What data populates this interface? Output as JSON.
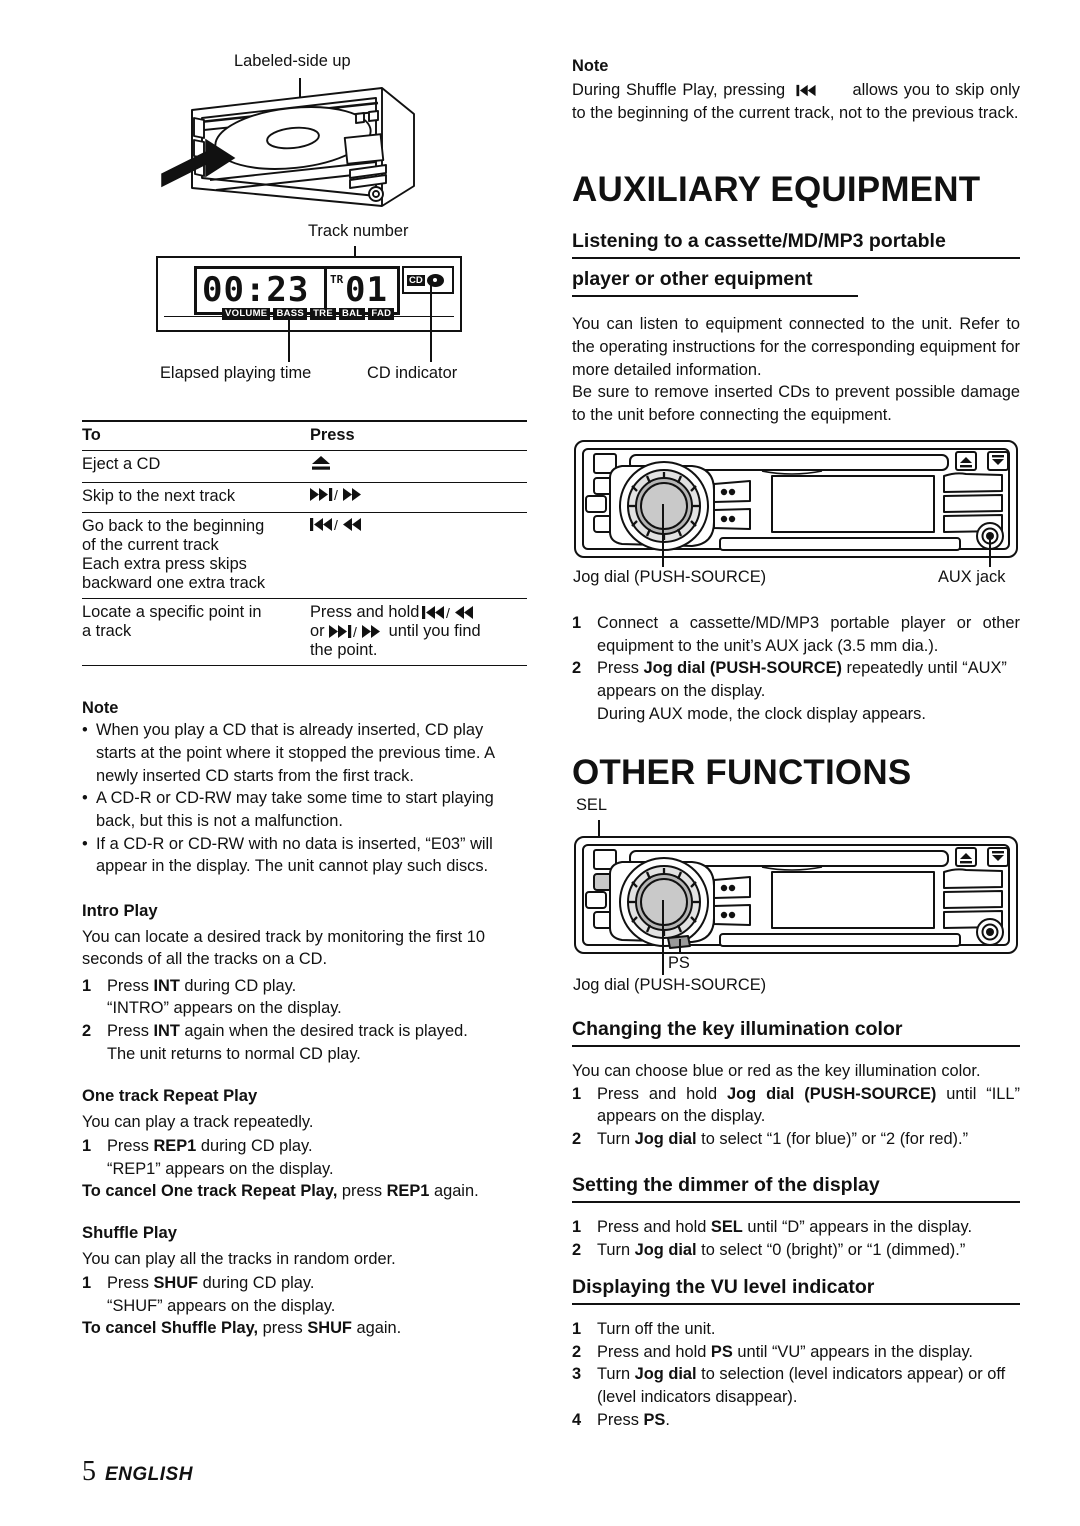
{
  "document": {
    "footer": {
      "page_number": "5",
      "language": "ENGLISH"
    }
  },
  "left_column": {
    "figure_cd_insert": {
      "label_top": "Labeled-side up"
    },
    "figure_display": {
      "label_track_number": "Track number",
      "label_elapsed": "Elapsed playing time",
      "label_cd_indicator": "CD indicator",
      "lcd": {
        "elapsed_time": "00:23",
        "track_prefix": "TR",
        "track_number": "01",
        "cd_tag": "CD",
        "indicators": [
          "VOLUME",
          "BASS",
          "TRE",
          "BAL",
          "FAD"
        ]
      }
    },
    "key_table": {
      "headers": {
        "to": "To",
        "press": "Press"
      },
      "rows": [
        {
          "to": "Eject a CD",
          "press": "⏏",
          "press_is_glyph": true
        },
        {
          "to": "Skip to the next track",
          "press": "▶▶⏸/▶▶"
        },
        {
          "to": "Go back to the beginning of the current track\nEach extra press skips backward one extra track",
          "press": "⏮◀◀/◀◀"
        },
        {
          "to": "Locate a specific point in a track",
          "press": "Press and hold ⏮◀◀ or ▶▶⏸/▶▶ until you find the point."
        }
      ]
    },
    "note": {
      "heading": "Note",
      "bullets": [
        "When you play a CD that is already inserted, CD play starts at the point where it stopped the previous time. A newly inserted CD starts from the first track.",
        "A CD-R or CD-RW may take some time to start playing back, but this is not a malfunction.",
        "If a CD-R or CD-RW with no data is inserted, “E03” will appear in the display. The unit cannot play such discs."
      ]
    },
    "intro_play": {
      "heading": "Intro Play",
      "intro": "You can locate a desired track by monitoring the first 10 seconds of all the tracks on a CD.",
      "steps": [
        {
          "num": "1",
          "text_prefix": "Press ",
          "bold": "INT",
          "text_suffix": " during CD play.",
          "sub": "“INTRO” appears on the display."
        },
        {
          "num": "2",
          "text_prefix": "Press ",
          "bold": "INT",
          "text_suffix": " again when the desired track is played.",
          "sub": "The unit returns to normal CD play."
        }
      ]
    },
    "one_track_repeat": {
      "heading": "One track Repeat Play",
      "intro": "You can play a track repeatedly.",
      "steps": [
        {
          "num": "1",
          "text_prefix": "Press ",
          "bold": "REP1",
          "text_suffix": " during CD play.",
          "sub": "“REP1” appears on the display."
        }
      ],
      "cancel_bold": "To cancel One track Repeat Play,",
      "cancel_mid": " press ",
      "cancel_bold2": "REP1",
      "cancel_end": " again."
    },
    "shuffle_play": {
      "heading": "Shuffle Play",
      "intro": "You can play all the tracks in random order.",
      "steps": [
        {
          "num": "1",
          "text_prefix": "Press ",
          "bold": "SHUF",
          "text_suffix": " during CD play.",
          "sub": "“SHUF” appears on the display."
        }
      ],
      "cancel_bold": "To cancel Shuffle Play,",
      "cancel_mid": " press ",
      "cancel_bold2": "SHUF",
      "cancel_end": " again."
    }
  },
  "right_column": {
    "note": {
      "heading": "Note",
      "text_before": "During Shuffle Play, pressing ",
      "glyph": "⏮◀◀",
      "text_after": " allows you to skip only to the beginning of the current track, not to the previous track."
    },
    "chapter_auxiliary": "AUXILIARY EQUIPMENT",
    "section_listening": {
      "line1": "Listening to a cassette/MD/MP3 portable",
      "line2": "player or other equipment",
      "paragraph1": "You can listen to equipment connected to the unit. Refer to the operating instructions for the corresponding equipment for more detailed information.",
      "paragraph2": "Be sure to remove inserted CDs to prevent possible damage to the unit before connecting the equipment.",
      "figure": {
        "label_jog": "Jog dial (PUSH-SOURCE)",
        "label_aux": "AUX jack"
      },
      "steps": [
        {
          "num": "1",
          "text": "Connect a cassette/MD/MP3 portable player or other equipment to the unit’s AUX jack (3.5 mm dia.)."
        },
        {
          "num": "2",
          "text_prefix": "Press ",
          "bold": "Jog dial (PUSH-SOURCE)",
          "text_suffix": " repeatedly until “AUX” appears on the display.",
          "sub": "During AUX mode, the clock display appears."
        }
      ]
    },
    "chapter_other_functions": "OTHER FUNCTIONS",
    "figure_other": {
      "label_sel": "SEL",
      "label_ps": "PS",
      "label_jog": "Jog dial (PUSH-SOURCE)"
    },
    "section_illumination": {
      "heading": "Changing the key illumination color",
      "intro": "You can choose blue or red as the key illumination color.",
      "steps": [
        {
          "num": "1",
          "text_prefix": "Press and hold ",
          "bold": "Jog dial (PUSH-SOURCE)",
          "text_suffix": " until “ILL” appears on the display."
        },
        {
          "num": "2",
          "text_prefix": "Turn ",
          "bold": "Jog dial",
          "text_suffix": " to select “1 (for blue)” or “2 (for red).”"
        }
      ]
    },
    "section_dimmer": {
      "heading": "Setting the dimmer of the display",
      "steps": [
        {
          "num": "1",
          "text_prefix": "Press and hold ",
          "bold": "SEL",
          "text_suffix": " until “D” appears in the display."
        },
        {
          "num": "2",
          "text_prefix": "Turn ",
          "bold": "Jog dial",
          "text_suffix": " to select “0 (bright)” or “1 (dimmed).”"
        }
      ]
    },
    "section_vu": {
      "heading": "Displaying the VU level indicator",
      "steps": [
        {
          "num": "1",
          "text": "Turn off the unit."
        },
        {
          "num": "2",
          "text_prefix": "Press and hold ",
          "bold": "PS",
          "text_suffix": " until “VU” appears in the display."
        },
        {
          "num": "3",
          "text_prefix": "Turn ",
          "bold": "Jog dial",
          "text_suffix": " to selection (level indicators appear) or off (level indicators disappear)."
        },
        {
          "num": "4",
          "text_prefix": "Press ",
          "bold": "PS",
          "text_suffix": "."
        }
      ]
    }
  }
}
